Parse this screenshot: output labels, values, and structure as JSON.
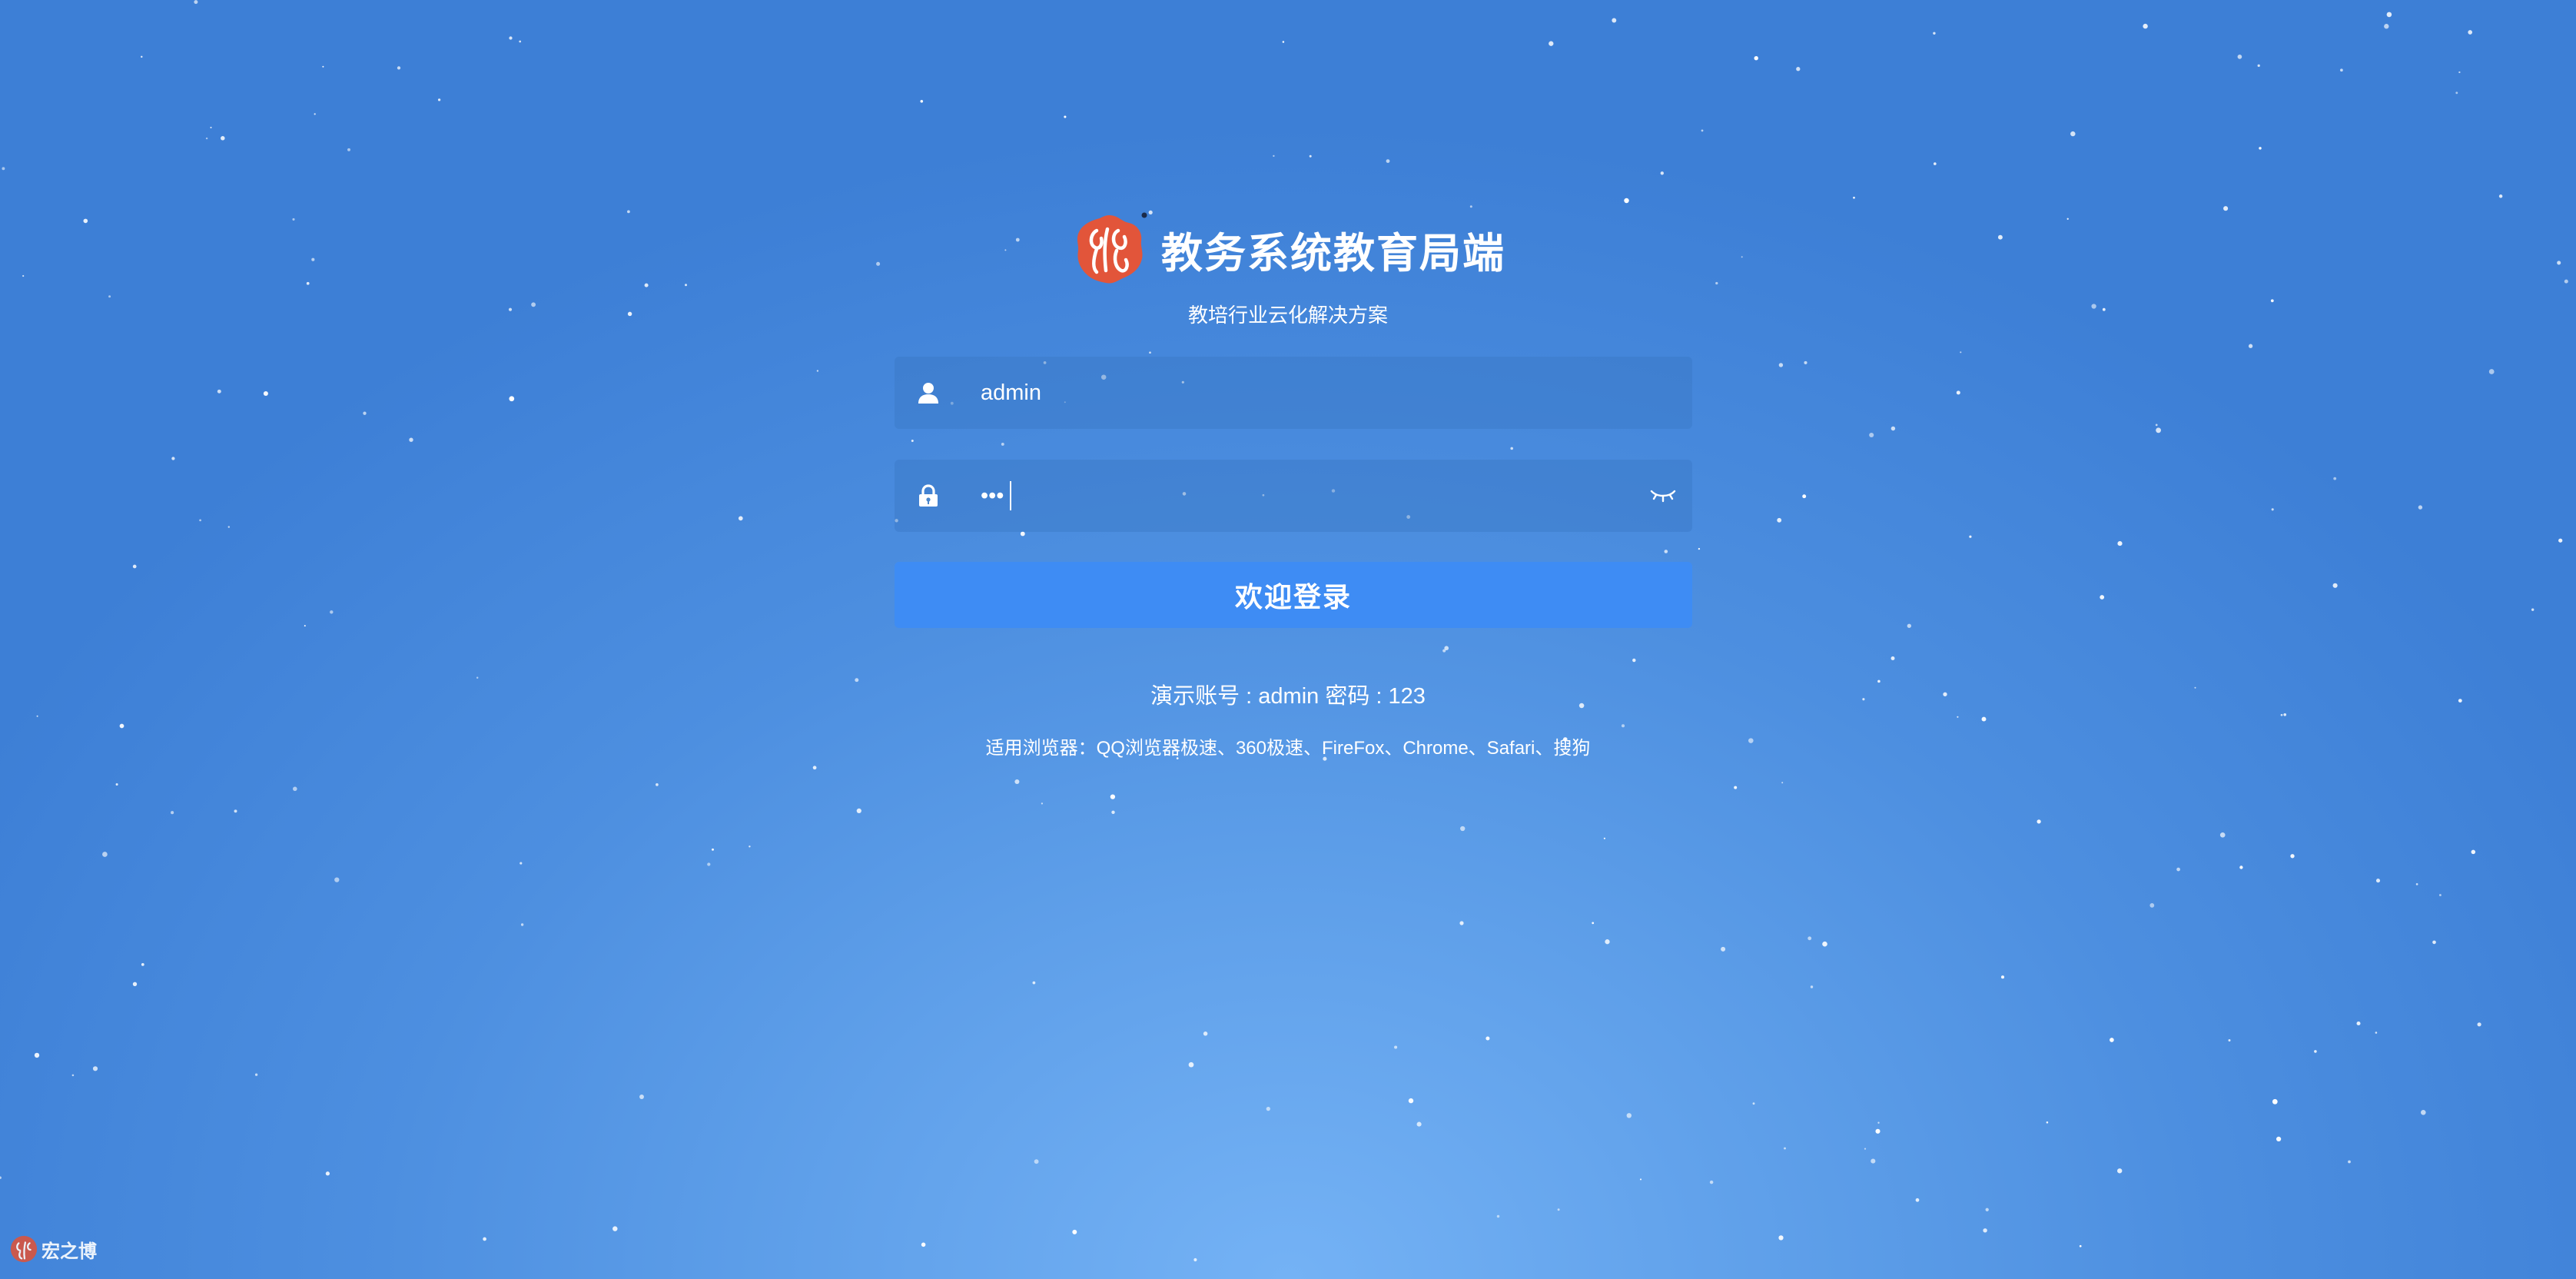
{
  "header": {
    "title": "教务系统教育局端",
    "subtitle": "教培行业云化解决方案",
    "logo_icon": "brand-logo-icon"
  },
  "login_form": {
    "username_value": "admin",
    "username_icon": "user-icon",
    "password_value": "123",
    "password_icon": "lock-icon",
    "toggle_icon": "eye-closed-icon",
    "submit_label": "欢迎登录"
  },
  "hints": {
    "demo_account": "演示账号 : admin 密码 : 123",
    "browser_support": "适用浏览器：QQ浏览器极速、360极速、FireFox、Chrome、Safari、搜狗"
  },
  "watermark": {
    "text": "宏之博"
  },
  "colors": {
    "background": "#4d8fe0",
    "field_background": "#4a86cc",
    "button": "#3e8cf4",
    "logo": "#e2553a"
  }
}
